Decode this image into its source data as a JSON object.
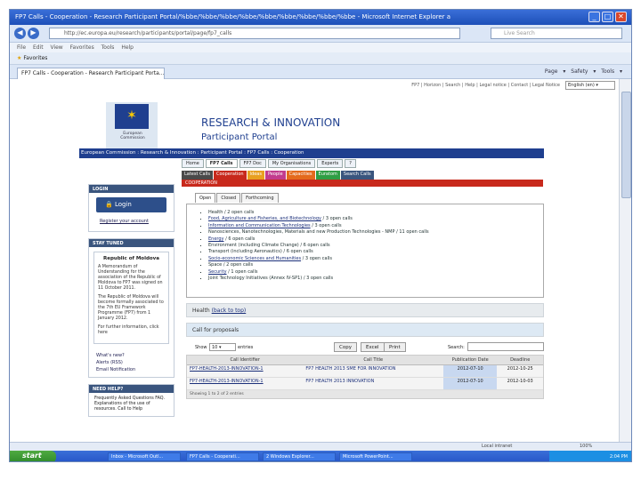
{
  "window": {
    "title": "FP7 Calls - Cooperation - Research Participant Portal/%bbe/%bbe/%bbe/%bbe/%bbe/%bbe/%bbe/%bbe/%bbe - Microsoft Internet Explorer a",
    "min": "_",
    "max": "□",
    "close": "✕"
  },
  "browser": {
    "url": "http://ec.europa.eu/research/participants/portal/page/fp7_calls",
    "search_placeholder": "Live Search",
    "menu": "File Edit View Favorites Tools Help",
    "favorites_label": "Favorites",
    "tab_label": "FP7 Calls - Cooperation - Research Participant Porta...",
    "tools": "Page ▾ Safety ▾ Tools ▾"
  },
  "page": {
    "toplinks": "FP7 | Horizon | Search | Help | Legal notice | Contact | Legal Notice",
    "language": "English (en)",
    "eu_label": "European Commission",
    "title": "RESEARCH & INNOVATION",
    "subtitle": "Participant Portal",
    "breadcrumb": "European Commission : Research & Innovation : Participant Portal : FP7 Calls : Cooperation",
    "main_nav": [
      {
        "label": "Home",
        "active": false
      },
      {
        "label": "FP7 Calls",
        "active": true
      },
      {
        "label": "FP7 Doc",
        "active": false
      },
      {
        "label": "My Organisations",
        "active": false
      },
      {
        "label": "Experts",
        "active": false
      },
      {
        "label": "?",
        "active": false
      }
    ],
    "sub_nav": [
      {
        "label": "Latest Calls",
        "color": "#4a4a4a"
      },
      {
        "label": "Cooperation",
        "color": "#c8291c"
      },
      {
        "label": "Ideas",
        "color": "#e8a020"
      },
      {
        "label": "People",
        "color": "#c23c8e"
      },
      {
        "label": "Capacities",
        "color": "#e46a1d"
      },
      {
        "label": "Euratom",
        "color": "#2f9e44"
      },
      {
        "label": "Search Calls",
        "color": "#3a557e"
      }
    ],
    "cooperation_heading": "COOPERATION"
  },
  "left": {
    "login_header": "LOGIN",
    "login_button": "Login",
    "register_link": "Register your account",
    "stay_tuned_header": "STAY TUNED",
    "news_title": "Republic of Moldova",
    "news_p1": "A Memorandum of Understanding for the association of the Republic of Moldova to FP7 was signed on 11 October 2011.",
    "news_p2": "The Republic of Moldova will become formally associated to the 7th EU Framework Programme (FP7) from 1 January 2012.",
    "news_p3": "For further information, click here",
    "links": [
      "What's new?",
      "Alerts (RSS)",
      "Email Notification"
    ],
    "need_help_header": "NEED HELP?",
    "help_text": "Frequently Asked Questions FAQ. Explanations of the use of resources. Call to Help"
  },
  "content": {
    "tabs": [
      {
        "label": "Open",
        "active": true
      },
      {
        "label": "Closed",
        "active": false
      },
      {
        "label": "Forthcoming",
        "active": false
      }
    ],
    "themes": [
      {
        "name": "Health",
        "calls": " / 2 open calls",
        "link": false
      },
      {
        "name": "Food, Agriculture and Fisheries, and Biotechnology",
        "calls": " / 3 open calls",
        "link": true
      },
      {
        "name": "Information and Communication Technologies",
        "calls": " / 3 open calls",
        "link": true
      },
      {
        "name": "Nanosciences, Nanotechnologies, Materials and new Production Technologies - NMP",
        "calls": " / 11 open calls",
        "link": false
      },
      {
        "name": "Energy",
        "calls": " / 6 open calls",
        "link": true
      },
      {
        "name": "Environment (including Climate Change)",
        "calls": " / 6 open calls",
        "link": false
      },
      {
        "name": "Transport (including Aeronautics)",
        "calls": " / 6 open calls",
        "link": false
      },
      {
        "name": "Socio-economic Sciences and Humanities",
        "calls": " / 3 open calls",
        "link": true
      },
      {
        "name": "Space",
        "calls": " / 2 open calls",
        "link": false
      },
      {
        "name": "Security",
        "calls": " / 1 open calls",
        "link": true
      },
      {
        "name": "Joint Technology Initiatives (Annex IV-SP1)",
        "calls": " / 3 open calls",
        "link": false
      }
    ],
    "section_title": "Health",
    "back_to_top": "(back to top)",
    "calls_header": "Call for proposals",
    "show_label": "Show",
    "show_value": "10",
    "entries_label": "entries",
    "buttons": [
      "Copy",
      "Excel",
      "Print"
    ],
    "search_label": "Search:",
    "columns": [
      "Call Identifier",
      "Call Title",
      "Publication Date",
      "Deadline"
    ],
    "rows": [
      {
        "id": "FP7-HEALTH-2013-INNOVATION-1",
        "title": "FP7 HEALTH 2013 SME FOR INNOVATION",
        "date": "2012-07-10",
        "deadline": "2012-10-25"
      },
      {
        "id": "FP7-HEALTH-2013-INNOVATION-1",
        "title": "FP7 HEALTH 2013 INNOVATION",
        "date": "2012-07-10",
        "deadline": "2012-10-03"
      }
    ],
    "footer": "Showing 1 to 2 of 2 entries"
  },
  "status": {
    "zone": "Local intranet",
    "zoom": "100%"
  },
  "taskbar": {
    "start": "start",
    "items": [
      "Inbox - Microsoft Outl...",
      "FP7 Calls - Cooperati...",
      "2 Windows Explorer...",
      "Microsoft PowerPoint..."
    ],
    "clock": "2:04 PM"
  }
}
